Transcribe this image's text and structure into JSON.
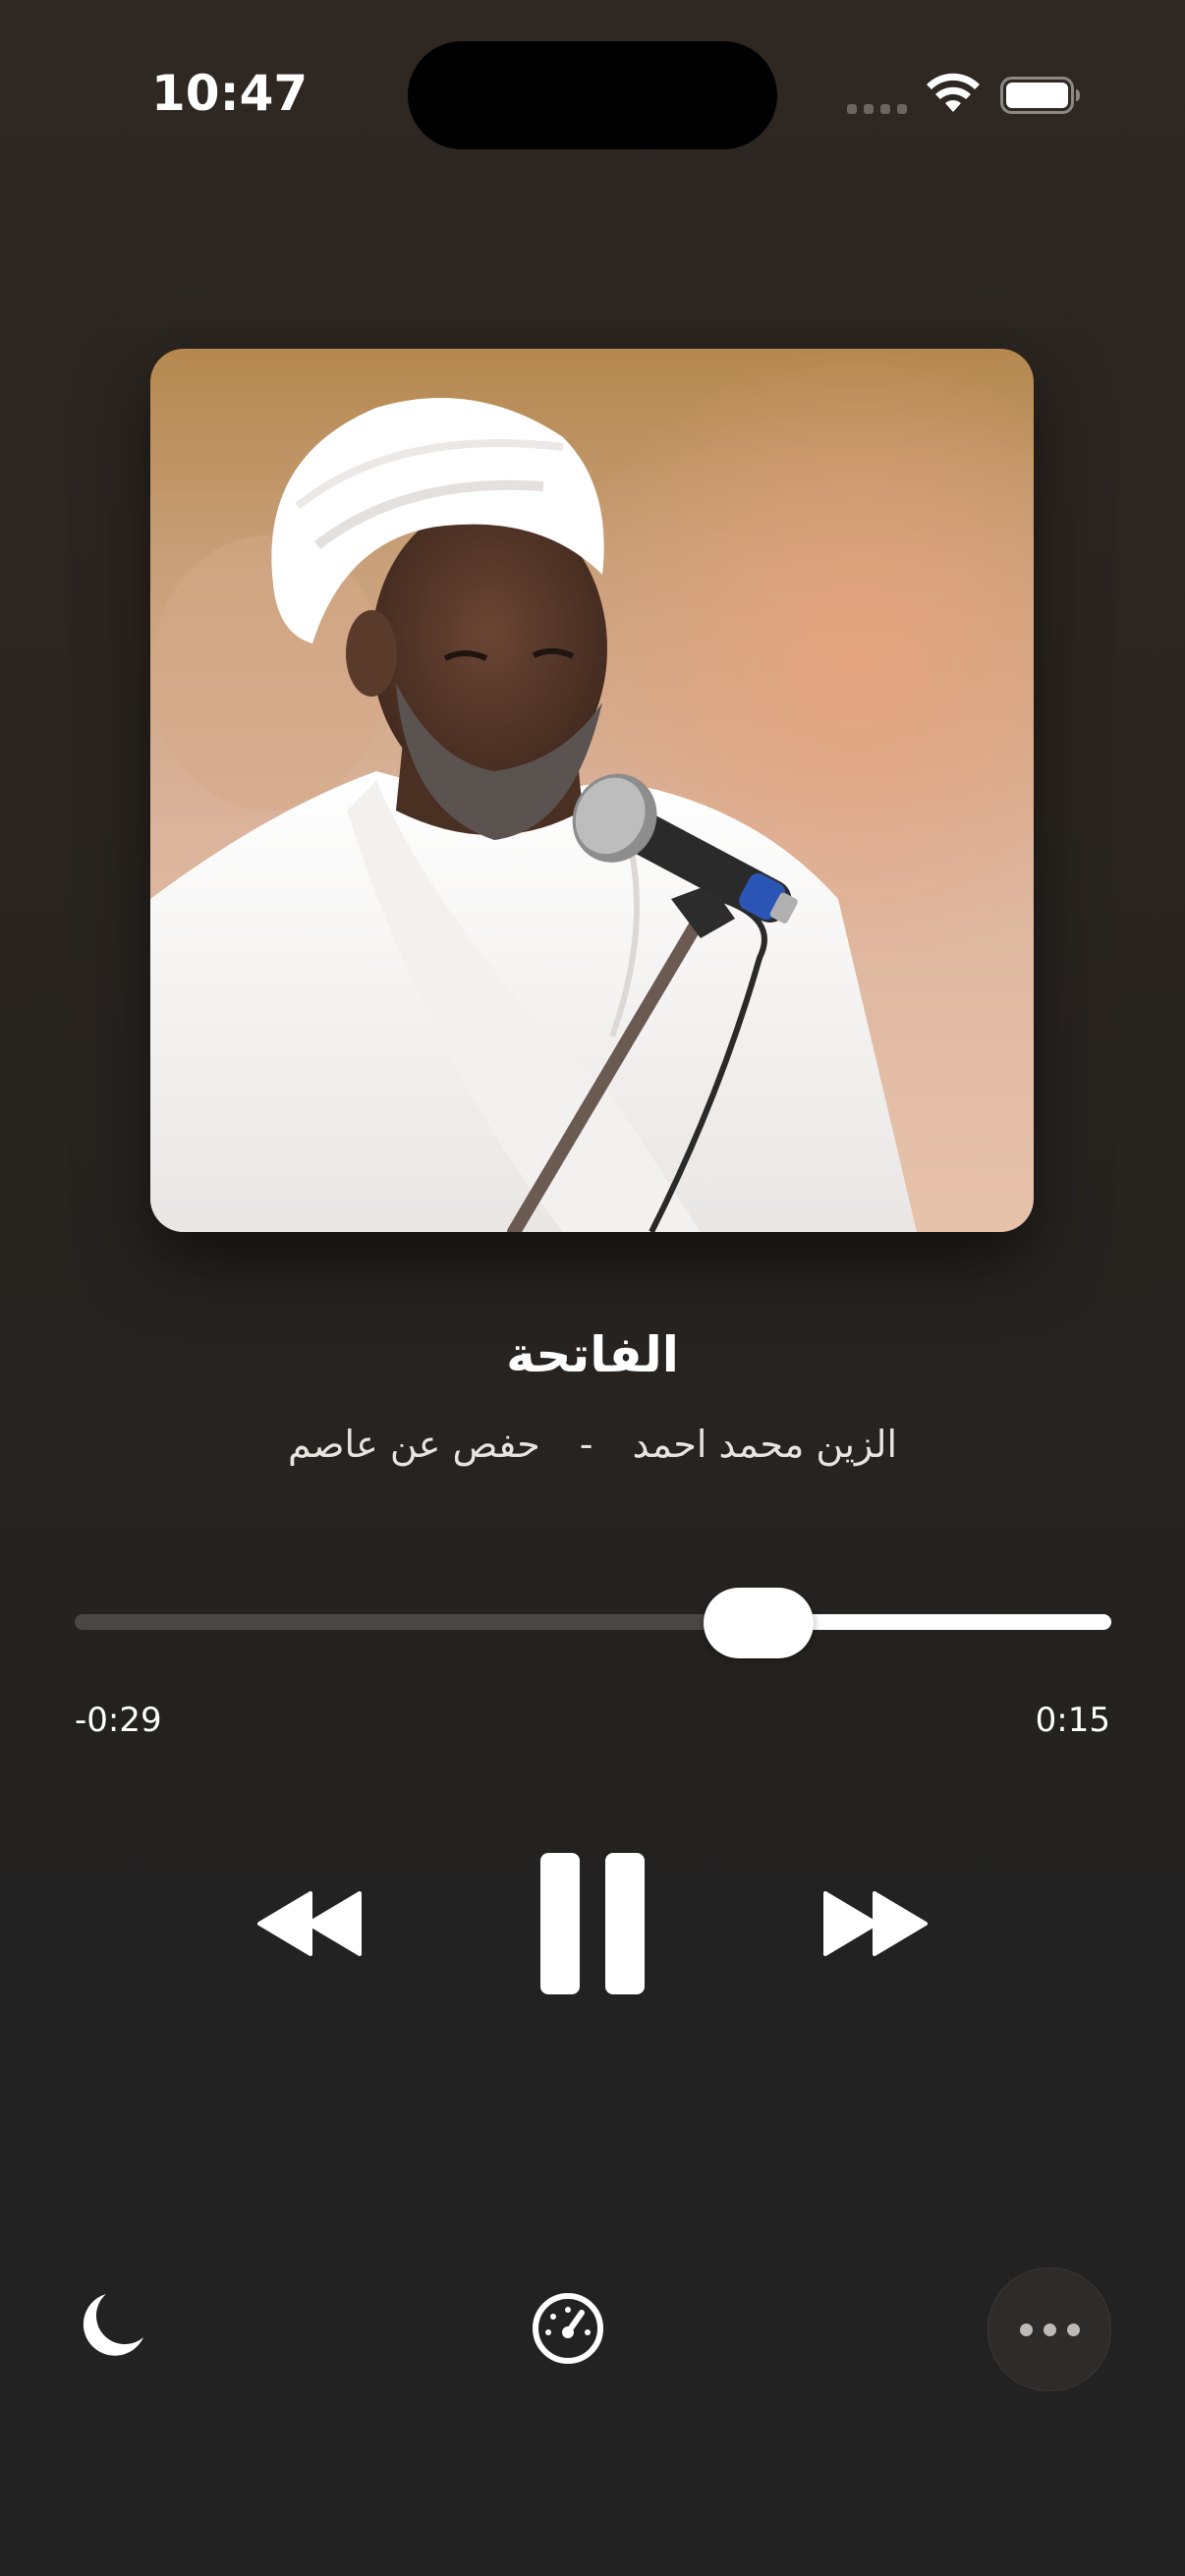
{
  "status_bar": {
    "time": "10:47",
    "signal_icon": "cellular-signal-icon",
    "wifi_icon": "wifi-icon",
    "battery_icon": "battery-icon"
  },
  "artwork": {
    "icon": "album-artwork-image"
  },
  "track": {
    "title": "الفاتحة",
    "reciter": "الزين محمد احمد",
    "separator": "-",
    "riwaya": "حفص عن عاصم"
  },
  "progress": {
    "elapsed": "0:15",
    "remaining": "-0:29",
    "fraction_played": 0.34
  },
  "controls": {
    "rewind_icon": "backward-icon",
    "pause_icon": "pause-icon",
    "forward_icon": "forward-icon"
  },
  "bottom_bar": {
    "sleep_icon": "moon-icon",
    "speed_icon": "speedometer-icon",
    "more_icon": "ellipsis-icon"
  },
  "colors": {
    "background": "#2a2520",
    "accent": "#ffffff",
    "track_inactive": "#4a4643"
  }
}
